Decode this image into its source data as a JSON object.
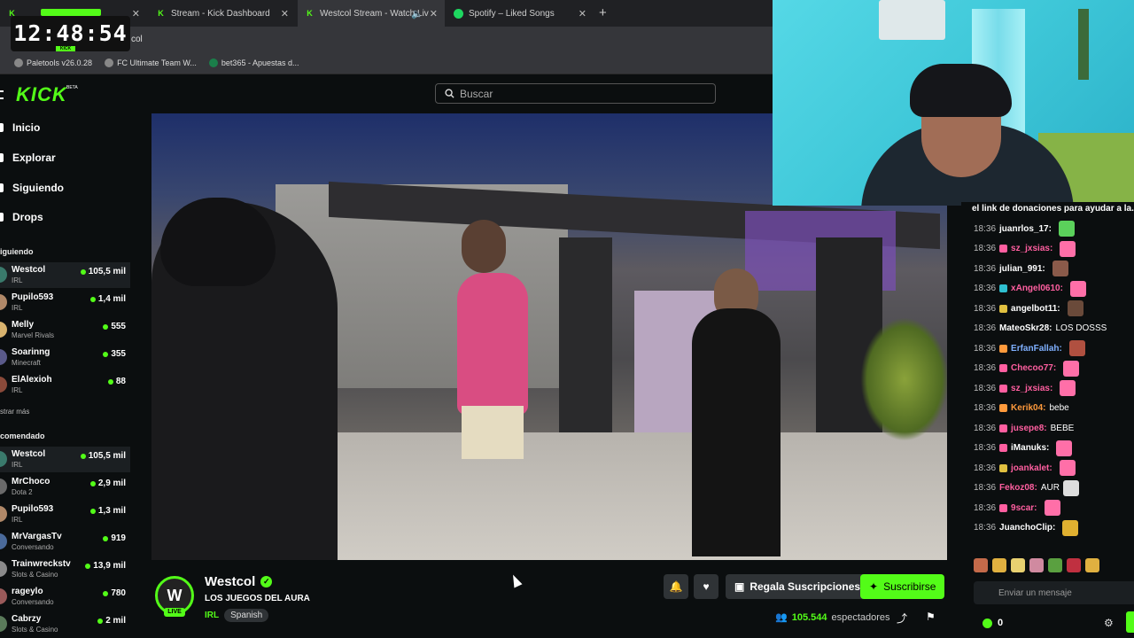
{
  "browser": {
    "tabs": [
      {
        "label": "",
        "favicon": "kick-icon"
      },
      {
        "label": "Stream - Kick Dashboard",
        "favicon": "kick-icon"
      },
      {
        "label": "Westcol Stream - Watch Liv",
        "favicon": "kick-icon"
      },
      {
        "label": "Spotify – Liked Songs",
        "favicon": "spotify-icon"
      }
    ],
    "url_fragment": "col",
    "bookmarks": [
      {
        "label": "Paletools v26.0.28"
      },
      {
        "label": "FC Ultimate Team W..."
      },
      {
        "label": "bet365 - Apuestas d..."
      }
    ]
  },
  "overlay": {
    "clock": "12:48:54",
    "clock_tag": "KICK"
  },
  "kick": {
    "logo": "KICK",
    "logo_badge": "BETA",
    "search_placeholder": "Buscar",
    "nav": [
      "Inicio",
      "Explorar",
      "Siguiendo",
      "Drops"
    ],
    "following_header": "iguiendo",
    "following": [
      {
        "name": "Westcol",
        "category": "IRL",
        "viewers": "105,5 mil"
      },
      {
        "name": "Pupilo593",
        "category": "IRL",
        "viewers": "1,4 mil"
      },
      {
        "name": "Melly",
        "category": "Marvel Rivals",
        "viewers": "555"
      },
      {
        "name": "Soarinng",
        "category": "Minecraft",
        "viewers": "355"
      },
      {
        "name": "ElAlexioh",
        "category": "IRL",
        "viewers": "88"
      }
    ],
    "show_more": "strar más",
    "recommended_header": "comendado",
    "recommended": [
      {
        "name": "Westcol",
        "category": "IRL",
        "viewers": "105,5 mil"
      },
      {
        "name": "MrChoco",
        "category": "Dota 2",
        "viewers": "2,9 mil"
      },
      {
        "name": "Pupilo593",
        "category": "IRL",
        "viewers": "1,3 mil"
      },
      {
        "name": "MrVargasTv",
        "category": "Conversando",
        "viewers": "919"
      },
      {
        "name": "Trainwreckstv",
        "category": "Slots & Casino",
        "viewers": "13,9 mil"
      },
      {
        "name": "rageylo",
        "category": "Conversando",
        "viewers": "780"
      },
      {
        "name": "Cabrzy",
        "category": "Slots & Casino",
        "viewers": "2 mil"
      }
    ]
  },
  "stream": {
    "channel": "Westcol",
    "avatar_letter": "W",
    "live_label": "LIVE",
    "title": "LOS JUEGOS DEL AURA",
    "category": "IRL",
    "language": "Spanish",
    "gift_label": "Regala Suscripciones",
    "subscribe_label": "Suscribirse",
    "viewers": "105.544",
    "viewers_label": "espectadores"
  },
  "chat": {
    "top_line": "el link de donaciones para ayudar a la...",
    "messages": [
      {
        "time": "18:36",
        "user": "juanrlos_17:",
        "color": "#ffffff",
        "text": ""
      },
      {
        "time": "18:36",
        "user": "sz_jxsias:",
        "color": "#ff5fa0",
        "text": ""
      },
      {
        "time": "18:36",
        "user": "julian_991:",
        "color": "#ffffff",
        "text": ""
      },
      {
        "time": "18:36",
        "user": "xAngel0610:",
        "color": "#ff5fa0",
        "text": ""
      },
      {
        "time": "18:36",
        "user": "angelbot11:",
        "color": "#ffffff",
        "text": ""
      },
      {
        "time": "18:36",
        "user": "MateoSkr28:",
        "color": "#ffffff",
        "text": "LOS DOSSS"
      },
      {
        "time": "18:36",
        "user": "ErfanFallah:",
        "color": "#7fb0ff",
        "text": ""
      },
      {
        "time": "18:36",
        "user": "Checoo77:",
        "color": "#ff5fa0",
        "text": ""
      },
      {
        "time": "18:36",
        "user": "sz_jxsias:",
        "color": "#ff5fa0",
        "text": ""
      },
      {
        "time": "18:36",
        "user": "Kerik04:",
        "color": "#ff9a3c",
        "text": "bebe"
      },
      {
        "time": "18:36",
        "user": "jusepe8:",
        "color": "#ff5fa0",
        "text": "BEBE"
      },
      {
        "time": "18:36",
        "user": "iManuks:",
        "color": "#ffffff",
        "text": ""
      },
      {
        "time": "18:36",
        "user": "joankalet:",
        "color": "#ff5fa0",
        "text": ""
      },
      {
        "time": "18:36",
        "user": "Fekoz08:",
        "color": "#ff5fa0",
        "text": "AUR"
      },
      {
        "time": "18:36",
        "user": "9scar:",
        "color": "#ff5fa0",
        "text": ""
      },
      {
        "time": "18:36",
        "user": "JuanchoClip:",
        "color": "#ffffff",
        "text": ""
      }
    ],
    "input_placeholder": "Enviar un mensaje",
    "points": "0"
  },
  "colors": {
    "accent": "#53fc18",
    "background": "#0b0e0f"
  }
}
